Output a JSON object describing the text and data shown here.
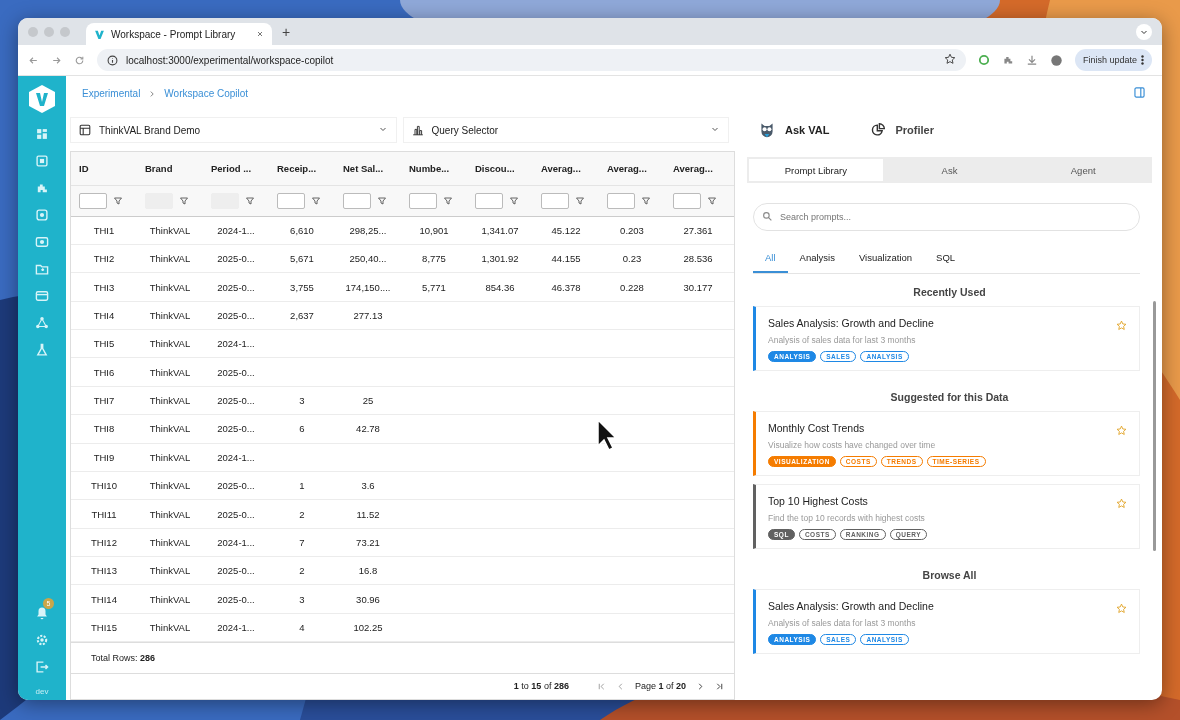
{
  "browser": {
    "tab_title": "Workspace - Prompt Library",
    "new_tab": "+",
    "url": "localhost:3000/experimental/workspace-copilot",
    "update_button": "Finish update"
  },
  "sidebar": {
    "notification_badge": "5",
    "env_label": "dev"
  },
  "breadcrumb": [
    "Experimental",
    "Workspace Copilot"
  ],
  "selectors": [
    {
      "kind": "table",
      "label": "ThinkVAL Brand Demo"
    },
    {
      "kind": "chart",
      "label": "Query Selector"
    }
  ],
  "table": {
    "columns": [
      "ID",
      "Brand",
      "Period ...",
      "Receip...",
      "Net Sal...",
      "Numbe...",
      "Discou...",
      "Averag...",
      "Averag...",
      "Averag..."
    ],
    "rows": [
      {
        "cells": [
          "THI1",
          "ThinkVAL",
          "2024-1...",
          "6,610",
          "298,25...",
          "10,901",
          "1,341.07",
          "45.122",
          "0.203",
          "27.361"
        ]
      },
      {
        "cells": [
          "THI2",
          "ThinkVAL",
          "2025-0...",
          "5,671",
          "250,40...",
          "8,775",
          "1,301.92",
          "44.155",
          "0.23",
          "28.536"
        ]
      },
      {
        "cells": [
          "THI3",
          "ThinkVAL",
          "2025-0...",
          "3,755",
          "174,150....",
          "5,771",
          "854.36",
          "46.378",
          "0.228",
          "30.177"
        ]
      },
      {
        "cells": [
          "THI4",
          "ThinkVAL",
          "2025-0...",
          "2,637",
          "277.13"
        ]
      },
      {
        "cells": [
          "THI5",
          "ThinkVAL",
          "2024-1..."
        ]
      },
      {
        "cells": [
          "THI6",
          "ThinkVAL",
          "2025-0..."
        ]
      },
      {
        "cells": [
          "THI7",
          "ThinkVAL",
          "2025-0...",
          "3",
          "25"
        ]
      },
      {
        "cells": [
          "THI8",
          "ThinkVAL",
          "2025-0...",
          "6",
          "42.78"
        ]
      },
      {
        "cells": [
          "THI9",
          "ThinkVAL",
          "2024-1..."
        ]
      },
      {
        "cells": [
          "THI10",
          "ThinkVAL",
          "2025-0...",
          "1",
          "3.6"
        ]
      },
      {
        "cells": [
          "THI11",
          "ThinkVAL",
          "2025-0...",
          "2",
          "11.52"
        ]
      },
      {
        "cells": [
          "THI12",
          "ThinkVAL",
          "2024-1...",
          "7",
          "73.21"
        ]
      },
      {
        "cells": [
          "THI13",
          "ThinkVAL",
          "2025-0...",
          "2",
          "16.8"
        ]
      },
      {
        "cells": [
          "THI14",
          "ThinkVAL",
          "2025-0...",
          "3",
          "30.96"
        ]
      },
      {
        "cells": [
          "THI15",
          "ThinkVAL",
          "2024-1...",
          "4",
          "102.25"
        ]
      }
    ],
    "total_rows": "Total Rows: **286**",
    "range": "**1** to **15** of **286**",
    "page": "Page **1** of **20**"
  },
  "assistant": {
    "tabs": [
      {
        "label": "Ask VAL",
        "selected": true
      },
      {
        "label": "Profiler",
        "selected": false
      }
    ],
    "modes": [
      {
        "label": "Prompt Library",
        "selected": true
      },
      {
        "label": "Ask",
        "selected": false
      },
      {
        "label": "Agent",
        "selected": false
      }
    ],
    "search": {
      "placeholder": "Search prompts..."
    },
    "categories": [
      {
        "label": "All",
        "selected": true
      },
      {
        "label": "Analysis",
        "selected": false
      },
      {
        "label": "Visualization",
        "selected": false
      },
      {
        "label": "SQL",
        "selected": false
      }
    ],
    "sections": [
      {
        "heading": "Recently Used",
        "cards": [
          {
            "title": "Sales Analysis: Growth and Decline",
            "description": "Analysis of sales data for last 3 months",
            "color": "#1e88e5",
            "tags": [
              "ANALYSIS",
              "SALES",
              "ANALYSIS"
            ]
          }
        ]
      },
      {
        "heading": "Suggested for this Data",
        "cards": [
          {
            "title": "Monthly Cost Trends",
            "description": "Visualize how costs have changed over time",
            "color": "#f57c00",
            "tags": [
              "VISUALIZATION",
              "COSTS",
              "TRENDS",
              "TIME-SERIES"
            ]
          },
          {
            "title": "Top 10 Highest Costs",
            "description": "Find the top 10 records with highest costs",
            "color": "#616161",
            "tags": [
              "SQL",
              "COSTS",
              "RANKING",
              "QUERY"
            ]
          }
        ]
      },
      {
        "heading": "Browse All",
        "cards": [
          {
            "title": "Sales Analysis: Growth and Decline",
            "description": "Analysis of sales data for last 3 months",
            "color": "#1e88e5",
            "tags": [
              "ANALYSIS",
              "SALES",
              "ANALYSIS"
            ]
          }
        ]
      }
    ]
  }
}
